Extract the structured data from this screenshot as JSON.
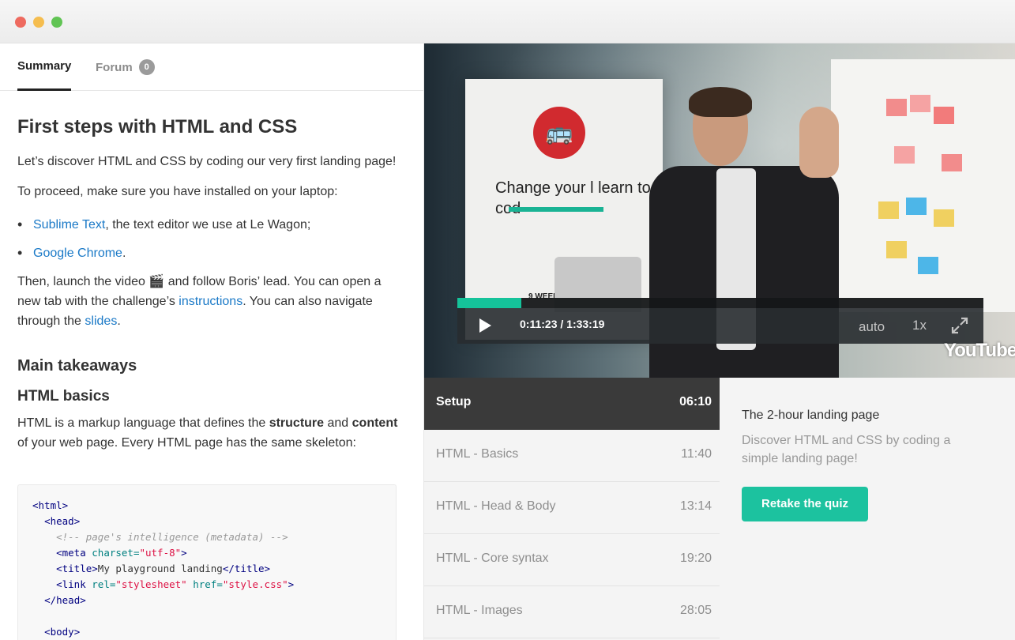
{
  "tabs": {
    "summary": "Summary",
    "forum": "Forum",
    "forum_count": "0"
  },
  "lesson": {
    "title": "First steps with HTML and CSS",
    "intro": "Let’s discover HTML and CSS by coding our very first landing page!",
    "proceed": "To proceed, make sure you have installed on your laptop:",
    "requirements": [
      {
        "link": "Sublime Text",
        "text": ", the text editor we use at Le Wagon;"
      },
      {
        "link": "Google Chrome",
        "text": "."
      }
    ],
    "then": {
      "part1": "Then, launch the video 🎬 and follow Boris’ lead. You can open a new tab with the challenge’s ",
      "link1": "instructions",
      "part2": ". You can also navigate through the ",
      "link2": "slides",
      "part3": "."
    },
    "takeaways_heading": "Main takeaways",
    "basics_heading": "HTML basics",
    "basics_text": {
      "part1": "HTML is a markup language that defines the ",
      "bold1": "structure",
      "part2": " and ",
      "bold2": "content",
      "part3": " of your web page. Every HTML page has the same skeleton:"
    },
    "code": {
      "line1": "<html>",
      "line2": "<head>",
      "line3": "<!-- page's intelligence (metadata) -->",
      "line4_tag": "<meta",
      "line4_attr": " charset=",
      "line4_val": "\"utf-8\"",
      "line4_end": ">",
      "line5_open": "<title>",
      "line5_text": "My playground landing",
      "line5_close": "</title>",
      "line6_tag": "<link",
      "line6_attr1": " rel=",
      "line6_val1": "\"stylesheet\"",
      "line6_attr2": " href=",
      "line6_val2": "\"style.css\"",
      "line6_end": ">",
      "line7": "</head>",
      "line9": "<body>"
    }
  },
  "video": {
    "time_current": "0:11:23",
    "time_separator": " / ",
    "time_total": "1:33:19",
    "progress_fraction": 0.122,
    "quality": "auto",
    "speed": "1x",
    "platform": "YouTube",
    "banner_text": "Change your l learn to cod",
    "banner_small": "9 WEEKS WEB DEVELOPE"
  },
  "chapters": [
    {
      "name": "Setup",
      "time": "06:10",
      "active": true
    },
    {
      "name": "HTML - Basics",
      "time": "11:40"
    },
    {
      "name": "HTML - Head & Body",
      "time": "13:14"
    },
    {
      "name": "HTML - Core syntax",
      "time": "19:20"
    },
    {
      "name": "HTML - Images",
      "time": "28:05"
    }
  ],
  "info": {
    "title": "The 2-hour landing page",
    "description": "Discover HTML and CSS by coding a simple landing page!",
    "quiz_button": "Retake the quiz"
  },
  "colors": {
    "accent": "#1cc29f",
    "link": "#1a79c7",
    "active_chapter": "#3a3a3a"
  }
}
